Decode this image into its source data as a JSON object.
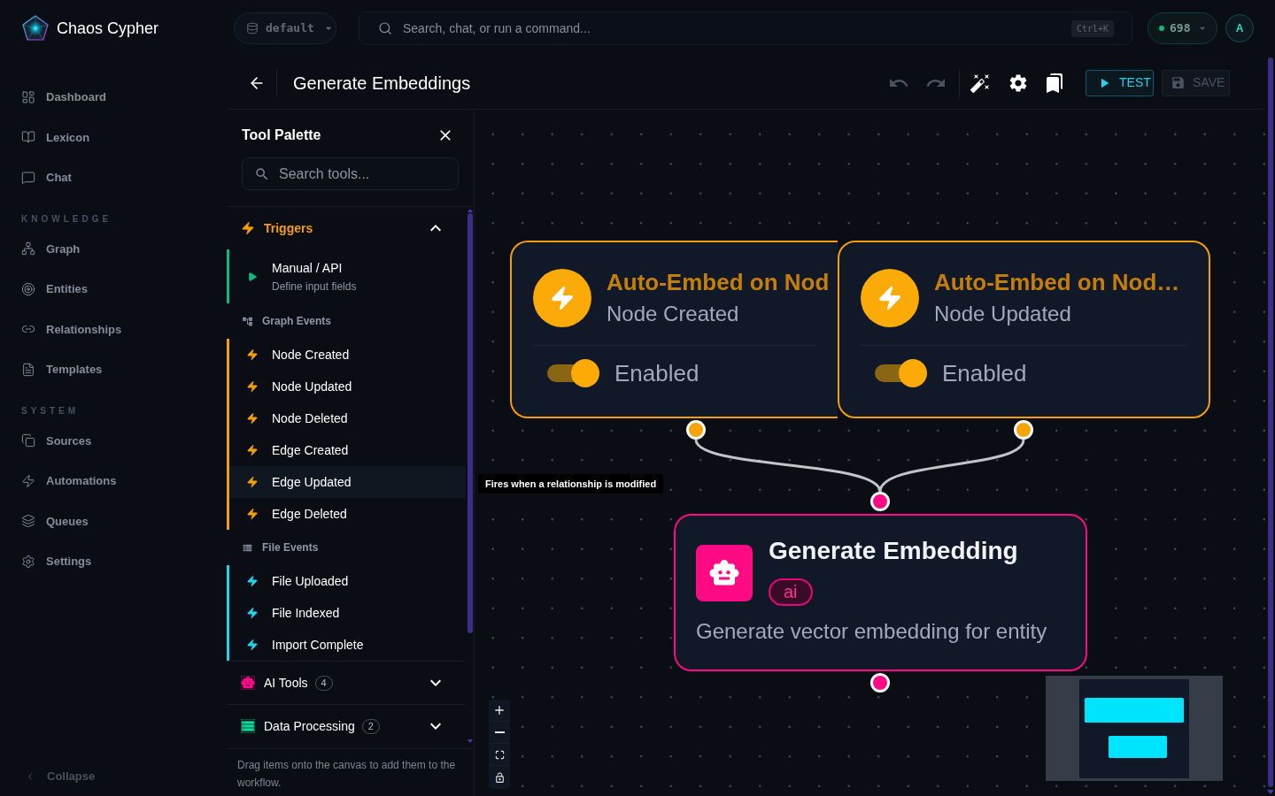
{
  "app": {
    "name": "Chaos Cypher"
  },
  "sidebar": {
    "groups": [
      {
        "items": [
          {
            "label": "Dashboard",
            "selected": false
          },
          {
            "label": "Lexicon",
            "selected": false
          },
          {
            "label": "Chat",
            "selected": false
          }
        ]
      },
      {
        "heading": "KNOWLEDGE",
        "items": [
          {
            "label": "Graph",
            "selected": false
          },
          {
            "label": "Entities",
            "selected": false
          },
          {
            "label": "Relationships",
            "selected": false
          },
          {
            "label": "Templates",
            "selected": false
          }
        ]
      },
      {
        "heading": "SYSTEM",
        "items": [
          {
            "label": "Sources",
            "selected": false
          },
          {
            "label": "Automations",
            "selected": false
          },
          {
            "label": "Queues",
            "selected": false
          },
          {
            "label": "Settings",
            "selected": false
          }
        ]
      }
    ],
    "collapse": "Collapse"
  },
  "topbar": {
    "workspace": "default",
    "search": {
      "placeholder": "Search, chat, or run a command...",
      "shortcut": "Ctrl+K"
    },
    "credits": "698",
    "avatar": "A"
  },
  "editor": {
    "title": "Generate Embeddings",
    "undo": {
      "disabled": true
    },
    "redo": {
      "disabled": true
    },
    "test_button": "TEST",
    "save_button": {
      "label": "SAVE",
      "disabled": true
    }
  },
  "palette": {
    "title": "Tool Palette",
    "search": {
      "placeholder": "Search tools..."
    },
    "sections": [
      {
        "label": "Triggers",
        "expanded": true,
        "color": "#f59e0b",
        "groups": [
          {
            "color": "#10b981",
            "items": [
              {
                "kind": "manual",
                "label": "Manual / API",
                "description": "Define input fields",
                "hovered": false
              }
            ]
          },
          {
            "heading": "Graph Events",
            "color": "#f59e0b",
            "items": [
              {
                "kind": "event",
                "label": "Node Created",
                "hovered": false
              },
              {
                "kind": "event",
                "label": "Node Updated",
                "hovered": false
              },
              {
                "kind": "event",
                "label": "Node Deleted",
                "hovered": false
              },
              {
                "kind": "event",
                "label": "Edge Created",
                "hovered": false
              },
              {
                "kind": "event",
                "label": "Edge Updated",
                "hovered": true
              },
              {
                "kind": "event",
                "label": "Edge Deleted",
                "hovered": false
              }
            ]
          },
          {
            "heading": "File Events",
            "color": "#22d3ee",
            "items": [
              {
                "kind": "event",
                "label": "File Uploaded",
                "hovered": false
              },
              {
                "kind": "event",
                "label": "File Indexed",
                "hovered": false
              },
              {
                "kind": "event",
                "label": "Import Complete",
                "hovered": false
              }
            ]
          }
        ]
      },
      {
        "label": "AI Tools",
        "count": "4",
        "expanded": false,
        "color": "#ff0a8c"
      },
      {
        "label": "Data Processing",
        "count": "2",
        "expanded": false,
        "color": "#10d9a0"
      }
    ],
    "tooltip": "Fires when a relationship is modified",
    "hint": "Drag items onto the canvas to add them to the workflow."
  },
  "canvas": {
    "nodes": [
      {
        "kind": "trigger",
        "title": "Auto-Embed on Nod",
        "subtitle": "Node Created",
        "toggle": {
          "label": "Enabled",
          "on": true
        }
      },
      {
        "kind": "trigger",
        "title": "Auto-Embed on Nod…",
        "subtitle": "Node Updated",
        "toggle": {
          "label": "Enabled",
          "on": true
        }
      },
      {
        "kind": "action",
        "title": "Generate Embedding",
        "tag": "ai",
        "description": "Generate vector embedding for entity"
      }
    ]
  }
}
